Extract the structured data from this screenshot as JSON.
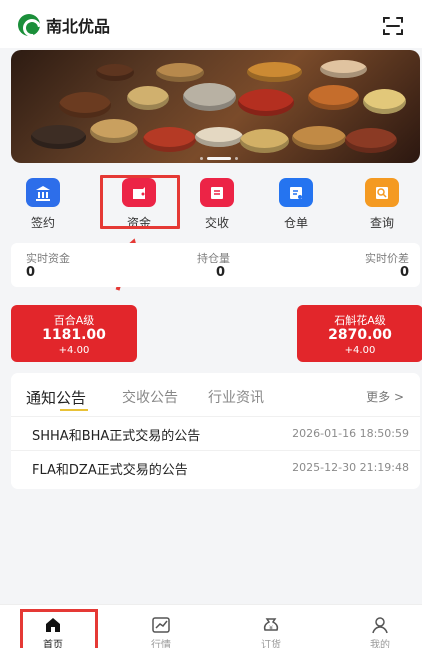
{
  "app": {
    "name": "南北优品"
  },
  "quick_actions": [
    {
      "label": "签约",
      "icon": "bank-icon",
      "color": "#2d6eea"
    },
    {
      "label": "资金",
      "icon": "wallet-icon",
      "color": "#ec2446"
    },
    {
      "label": "交收",
      "icon": "list-icon",
      "color": "#ec2446"
    },
    {
      "label": "仓单",
      "icon": "warehouse-receipt-icon",
      "color": "#2574f0"
    },
    {
      "label": "查询",
      "icon": "search-icon",
      "color": "#f49a22"
    }
  ],
  "stats": [
    {
      "label": "实时资金",
      "value": "0"
    },
    {
      "label": "持仓量",
      "value": "0"
    },
    {
      "label": "实时价差",
      "value": "0"
    }
  ],
  "price_cards": [
    {
      "name": "百合A级",
      "price": "1181.00",
      "change": "+4.00"
    },
    {
      "name": "石斛花A级",
      "price": "2870.00",
      "change": "+4.00"
    }
  ],
  "notice_tabs": [
    {
      "label": "通知公告",
      "active": true
    },
    {
      "label": "交收公告",
      "active": false
    },
    {
      "label": "行业资讯",
      "active": false
    }
  ],
  "more": "更多 >",
  "notices": [
    {
      "title": "SHHA和BHA正式交易的公告",
      "time": "2026-01-16 18:50:59"
    },
    {
      "title": "FLA和DZA正式交易的公告",
      "time": "2025-12-30 21:19:48"
    }
  ],
  "bottom_nav": [
    {
      "label": "首页",
      "icon": "home-icon",
      "active": true
    },
    {
      "label": "行情",
      "icon": "chart-icon",
      "active": false
    },
    {
      "label": "订货",
      "icon": "order-icon",
      "active": false
    },
    {
      "label": "我的",
      "icon": "profile-icon",
      "active": false
    }
  ],
  "colors": {
    "red": "#e2262b",
    "annotation_red": "#e53935",
    "green": "#1b8f3a",
    "underline": "#e9c237"
  }
}
